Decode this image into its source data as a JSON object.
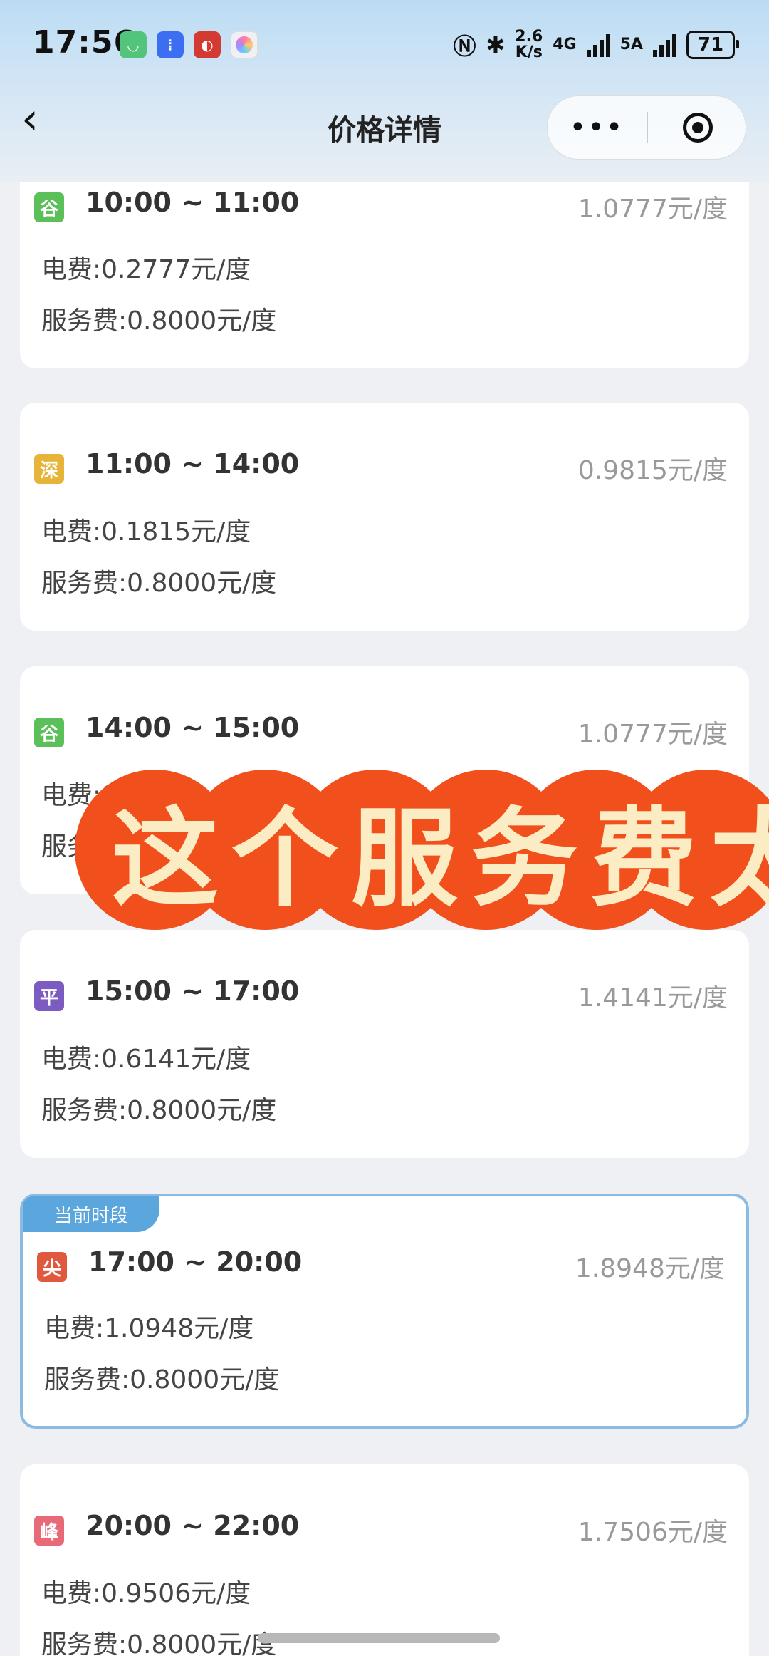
{
  "status_bar": {
    "time": "17:56",
    "speed_top": "2.6",
    "speed_unit": "K/s",
    "net1": "4G",
    "net2": "5A",
    "battery": "71",
    "icons": [
      "mi-home-icon",
      "voice-assistant-icon",
      "red-app-icon",
      "color-ring-app-icon",
      "nfc-icon",
      "bluetooth-icon"
    ]
  },
  "nav": {
    "title": "价格详情",
    "more_icon": "more-dots-icon",
    "close_icon": "target-circle-icon"
  },
  "colors": {
    "valley": "#5cc05a",
    "deep": "#e7b43a",
    "flat": "#7c5cc1",
    "sharp": "#e0583e",
    "peak": "#e86a78",
    "current_border": "#8bbbe3",
    "badge": "#5ba6dc",
    "banner": "#f14f1c"
  },
  "periods": [
    {
      "tag": "谷",
      "range": "10:00 ~ 11:00",
      "price": "1.0777元/度",
      "electric": "电费:0.2777元/度",
      "service": "服务费:0.8000元/度"
    },
    {
      "tag": "深",
      "range": "11:00 ~ 14:00",
      "price": "0.9815元/度",
      "electric": "电费:0.1815元/度",
      "service": "服务费:0.8000元/度"
    },
    {
      "tag": "谷",
      "range": "14:00 ~ 15:00",
      "price": "1.0777元/度",
      "electric": "电费:0",
      "service": "服务"
    },
    {
      "tag": "平",
      "range": "15:00 ~ 17:00",
      "price": "1.4141元/度",
      "electric": "电费:0.6141元/度",
      "service": "服务费:0.8000元/度"
    },
    {
      "tag": "尖",
      "range": "17:00 ~ 20:00",
      "price": "1.8948元/度",
      "electric": "电费:1.0948元/度",
      "service": "服务费:0.8000元/度",
      "badge": "当前时段"
    },
    {
      "tag": "峰",
      "range": "20:00 ~ 22:00",
      "price": "1.7506元/度",
      "electric": "电费:0.9506元/度",
      "service": "服务费:0.8000元/度"
    }
  ],
  "overlay_banner": "这个服务费太"
}
